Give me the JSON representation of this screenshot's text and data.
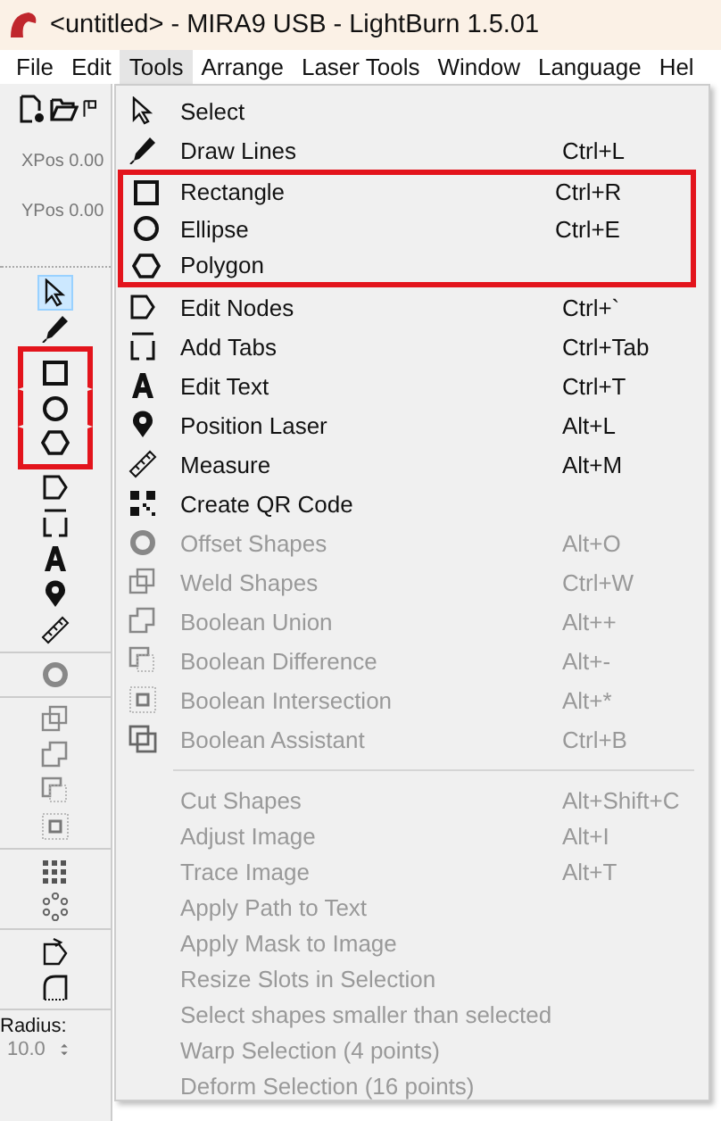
{
  "window": {
    "title": "<untitled> - MIRA9 USB - LightBurn 1.5.01"
  },
  "menubar": [
    {
      "label": "File",
      "selected": false
    },
    {
      "label": "Edit",
      "selected": false
    },
    {
      "label": "Tools",
      "selected": true
    },
    {
      "label": "Arrange",
      "selected": false
    },
    {
      "label": "Laser Tools",
      "selected": false
    },
    {
      "label": "Window",
      "selected": false
    },
    {
      "label": "Language",
      "selected": false
    },
    {
      "label": "Hel",
      "selected": false
    }
  ],
  "position": [
    {
      "label": "XPos 0.00"
    },
    {
      "label": "YPos 0.00"
    }
  ],
  "tool_groups": [
    {
      "tools": [
        {
          "selected": true,
          "highlighted": false
        },
        {
          "selected": false,
          "highlighted": false
        },
        {
          "selected": false,
          "highlighted": true
        },
        {
          "selected": false,
          "highlighted": true
        },
        {
          "selected": false,
          "highlighted": true
        },
        {
          "selected": false,
          "highlighted": false
        },
        {
          "selected": false,
          "highlighted": false
        },
        {
          "selected": false,
          "highlighted": false
        },
        {
          "selected": false,
          "highlighted": false
        },
        {
          "selected": false,
          "highlighted": false
        }
      ]
    },
    {
      "tools": [
        {
          "selected": false,
          "highlighted": false
        }
      ]
    },
    {
      "tools": [
        {
          "selected": false,
          "highlighted": false
        },
        {
          "selected": false,
          "highlighted": false
        },
        {
          "selected": false,
          "highlighted": false
        },
        {
          "selected": false,
          "highlighted": false
        }
      ]
    },
    {
      "tools": [
        {
          "selected": false,
          "highlighted": false
        },
        {
          "selected": false,
          "highlighted": false
        }
      ]
    },
    {
      "tools": [
        {
          "selected": false,
          "highlighted": false
        },
        {
          "selected": false,
          "highlighted": false
        }
      ]
    }
  ],
  "radius": {
    "label": "Radius:",
    "value": "10.0"
  },
  "menu": {
    "sections": [
      {
        "items": [
          {
            "label": "Select",
            "disabled": false,
            "highlighted": false
          },
          {
            "label": "Draw Lines",
            "shortcut": "Ctrl+L",
            "disabled": false,
            "highlighted": false
          },
          {
            "label": "Rectangle",
            "shortcut": "Ctrl+R",
            "disabled": false,
            "highlighted": true
          },
          {
            "label": "Ellipse",
            "shortcut": "Ctrl+E",
            "disabled": false,
            "highlighted": true
          },
          {
            "label": "Polygon",
            "disabled": false,
            "highlighted": true
          },
          {
            "label": "Edit Nodes",
            "shortcut": "Ctrl+`",
            "disabled": false,
            "highlighted": false
          },
          {
            "label": "Add Tabs",
            "shortcut": "Ctrl+Tab",
            "disabled": false,
            "highlighted": false
          },
          {
            "label": "Edit Text",
            "shortcut": "Ctrl+T",
            "disabled": false,
            "highlighted": false
          },
          {
            "label": "Position Laser",
            "shortcut": "Alt+L",
            "disabled": false,
            "highlighted": false
          },
          {
            "label": "Measure",
            "shortcut": "Alt+M",
            "disabled": false,
            "highlighted": false
          },
          {
            "label": "Create QR Code",
            "disabled": false,
            "highlighted": false
          },
          {
            "label": "Offset Shapes",
            "shortcut": "Alt+O",
            "disabled": true,
            "highlighted": false
          },
          {
            "label": "Weld Shapes",
            "shortcut": "Ctrl+W",
            "disabled": true,
            "highlighted": false
          },
          {
            "label": "Boolean Union",
            "shortcut": "Alt++",
            "disabled": true,
            "highlighted": false
          },
          {
            "label": "Boolean Difference",
            "shortcut": "Alt+-",
            "disabled": true,
            "highlighted": false
          },
          {
            "label": "Boolean Intersection",
            "shortcut": "Alt+*",
            "disabled": true,
            "highlighted": false
          },
          {
            "label": "Boolean Assistant",
            "shortcut": "Ctrl+B",
            "disabled": true,
            "highlighted": false
          }
        ]
      },
      {
        "items": [
          {
            "label": "Cut Shapes",
            "shortcut": "Alt+Shift+C",
            "disabled": true,
            "highlighted": false
          },
          {
            "label": "Adjust Image",
            "shortcut": "Alt+I",
            "disabled": true,
            "highlighted": false
          },
          {
            "label": "Trace Image",
            "shortcut": "Alt+T",
            "disabled": true,
            "highlighted": false
          },
          {
            "label": "Apply Path to Text",
            "disabled": true,
            "highlighted": false
          },
          {
            "label": "Apply Mask to Image",
            "disabled": true,
            "highlighted": false
          },
          {
            "label": "Resize Slots in Selection",
            "disabled": true,
            "highlighted": false
          },
          {
            "label": "Select shapes smaller than selected",
            "disabled": true,
            "highlighted": false
          },
          {
            "label": "Warp Selection (4 points)",
            "disabled": true,
            "highlighted": false
          },
          {
            "label": "Deform Selection (16 points)",
            "disabled": true,
            "highlighted": false
          }
        ]
      }
    ]
  }
}
